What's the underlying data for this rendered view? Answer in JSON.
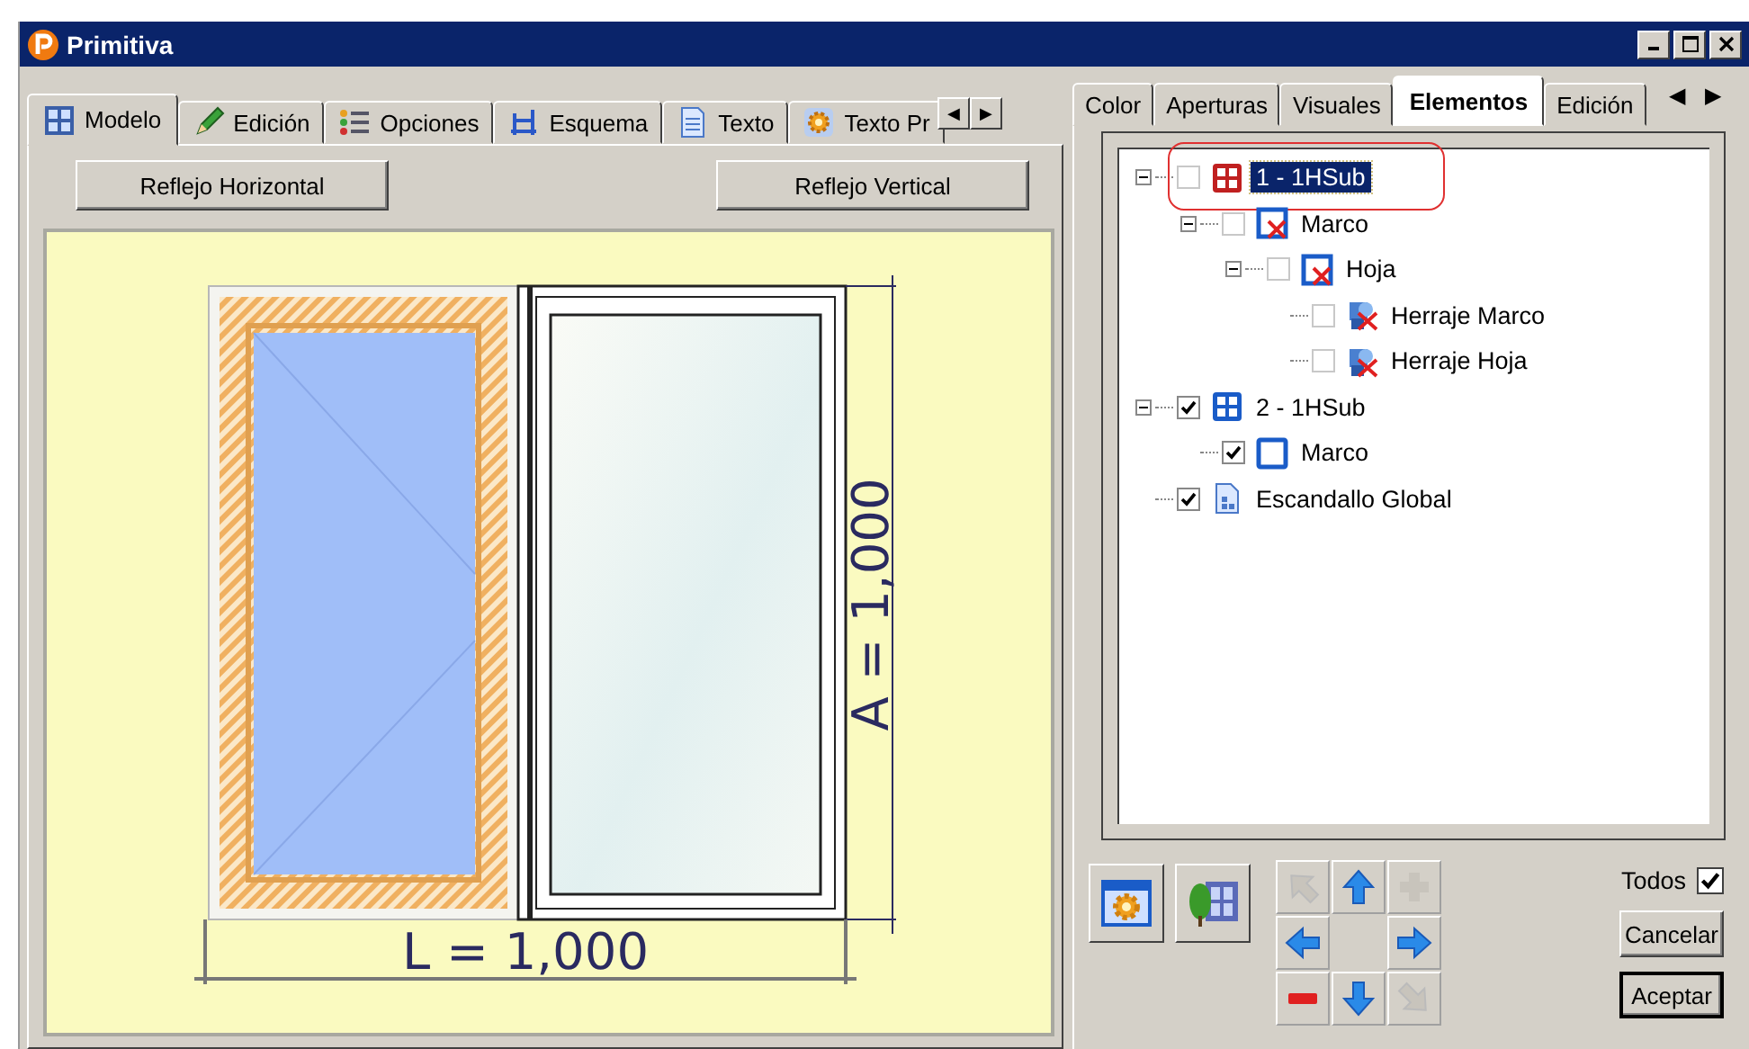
{
  "window": {
    "title": "Primitiva"
  },
  "left_tabs": [
    {
      "label": "Modelo",
      "kind": "grid",
      "selected": true
    },
    {
      "label": "Edición",
      "kind": "pencil",
      "selected": false
    },
    {
      "label": "Opciones",
      "kind": "list",
      "selected": false
    },
    {
      "label": "Esquema",
      "kind": "scheme",
      "selected": false
    },
    {
      "label": "Texto",
      "kind": "document",
      "selected": false
    },
    {
      "label": "Texto Pr",
      "kind": "gear",
      "selected": false
    }
  ],
  "left_tab_scroll": [
    "◀",
    "▶"
  ],
  "mirror_buttons": [
    "Reflejo Horizontal",
    "Reflejo Vertical"
  ],
  "drawing": {
    "width_label": "L = 1,000",
    "height_label": "A = 1,000"
  },
  "right_tabs": [
    {
      "label": "Color",
      "selected": false
    },
    {
      "label": "Aperturas",
      "selected": false
    },
    {
      "label": "Visuales",
      "selected": false
    },
    {
      "label": "Elementos",
      "selected": true
    },
    {
      "label": "Edición",
      "selected": false
    }
  ],
  "right_tab_scroll": [
    "◀",
    "▶"
  ],
  "tree": [
    {
      "label": "1 - 1HSub",
      "kind": "grid-red",
      "checked": false,
      "selected": true,
      "circled": true,
      "expanded": true,
      "children": [
        {
          "label": "Marco",
          "kind": "frame-x",
          "checked": false,
          "selected": false,
          "expanded": true,
          "children": [
            {
              "label": "Hoja",
              "kind": "frame-x",
              "checked": false,
              "selected": false,
              "expanded": true,
              "children": [
                {
                  "label": "Herraje Marco",
                  "kind": "hardware-x",
                  "checked": false,
                  "selected": false
                },
                {
                  "label": "Herraje Hoja",
                  "kind": "hardware-x",
                  "checked": false,
                  "selected": false
                }
              ]
            }
          ]
        }
      ]
    },
    {
      "label": "2 - 1HSub",
      "kind": "grid",
      "checked": true,
      "selected": false,
      "expanded": true,
      "children": [
        {
          "label": "Marco",
          "kind": "frame",
          "checked": true,
          "selected": false
        }
      ]
    },
    {
      "label": "Escandallo Global",
      "kind": "costing",
      "checked": true,
      "selected": false
    }
  ],
  "pad": [
    {
      "kind": "up-left",
      "disabled": true
    },
    {
      "kind": "up",
      "disabled": false
    },
    {
      "kind": "plus",
      "disabled": true
    },
    {
      "kind": "left",
      "disabled": false
    },
    {
      "kind": "blank"
    },
    {
      "kind": "right",
      "disabled": false
    },
    {
      "kind": "minus",
      "disabled": false
    },
    {
      "kind": "down",
      "disabled": false
    },
    {
      "kind": "down-right",
      "disabled": true
    }
  ],
  "all_checkbox": {
    "label": "Todos",
    "checked": true
  },
  "dialog_buttons": [
    {
      "label": "Cancelar",
      "default": false
    },
    {
      "label": "Aceptar",
      "default": true
    }
  ]
}
